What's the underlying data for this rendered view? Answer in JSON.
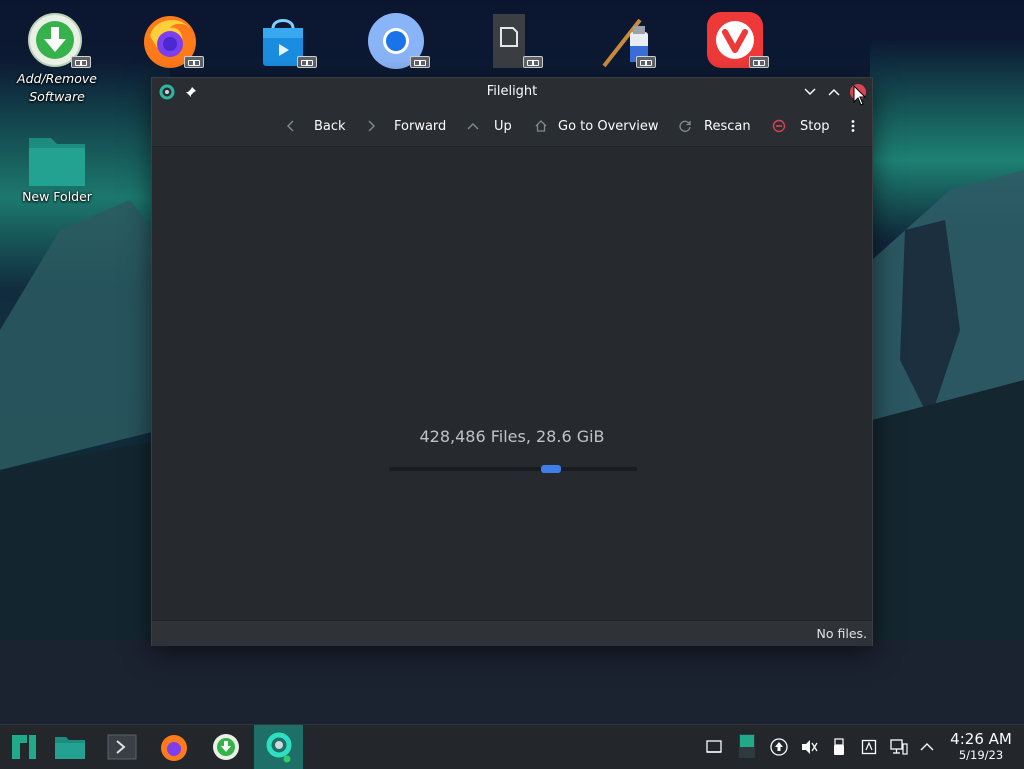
{
  "desktop": {
    "icons": [
      {
        "label": "Add/Remove Software",
        "icon": "software-download-icon"
      },
      {
        "label": "",
        "icon": "firefox-icon"
      },
      {
        "label": "",
        "icon": "software-store-icon"
      },
      {
        "label": "",
        "icon": "chromium-icon"
      },
      {
        "label": "",
        "icon": "document-viewer-icon"
      },
      {
        "label": "",
        "icon": "paint-app-icon"
      },
      {
        "label": "",
        "icon": "vivaldi-icon"
      },
      {
        "label": "New Folder",
        "icon": "folder-icon"
      }
    ]
  },
  "window": {
    "title": "Filelight",
    "toolbar": {
      "back": "Back",
      "forward": "Forward",
      "up": "Up",
      "overview": "Go to Overview",
      "rescan": "Rescan",
      "stop": "Stop"
    },
    "summary": "428,486 Files, 28.6 GiB",
    "status": "No files.",
    "scan_progress_indeterminate": true
  },
  "taskbar": {
    "clock": {
      "time": "4:26 AM",
      "date": "5/19/23"
    }
  },
  "colors": {
    "accent": "#3d7eea",
    "window_bg": "#2a2e32",
    "taskbar_active": "#1d6f68",
    "stop_red": "#da4453"
  }
}
